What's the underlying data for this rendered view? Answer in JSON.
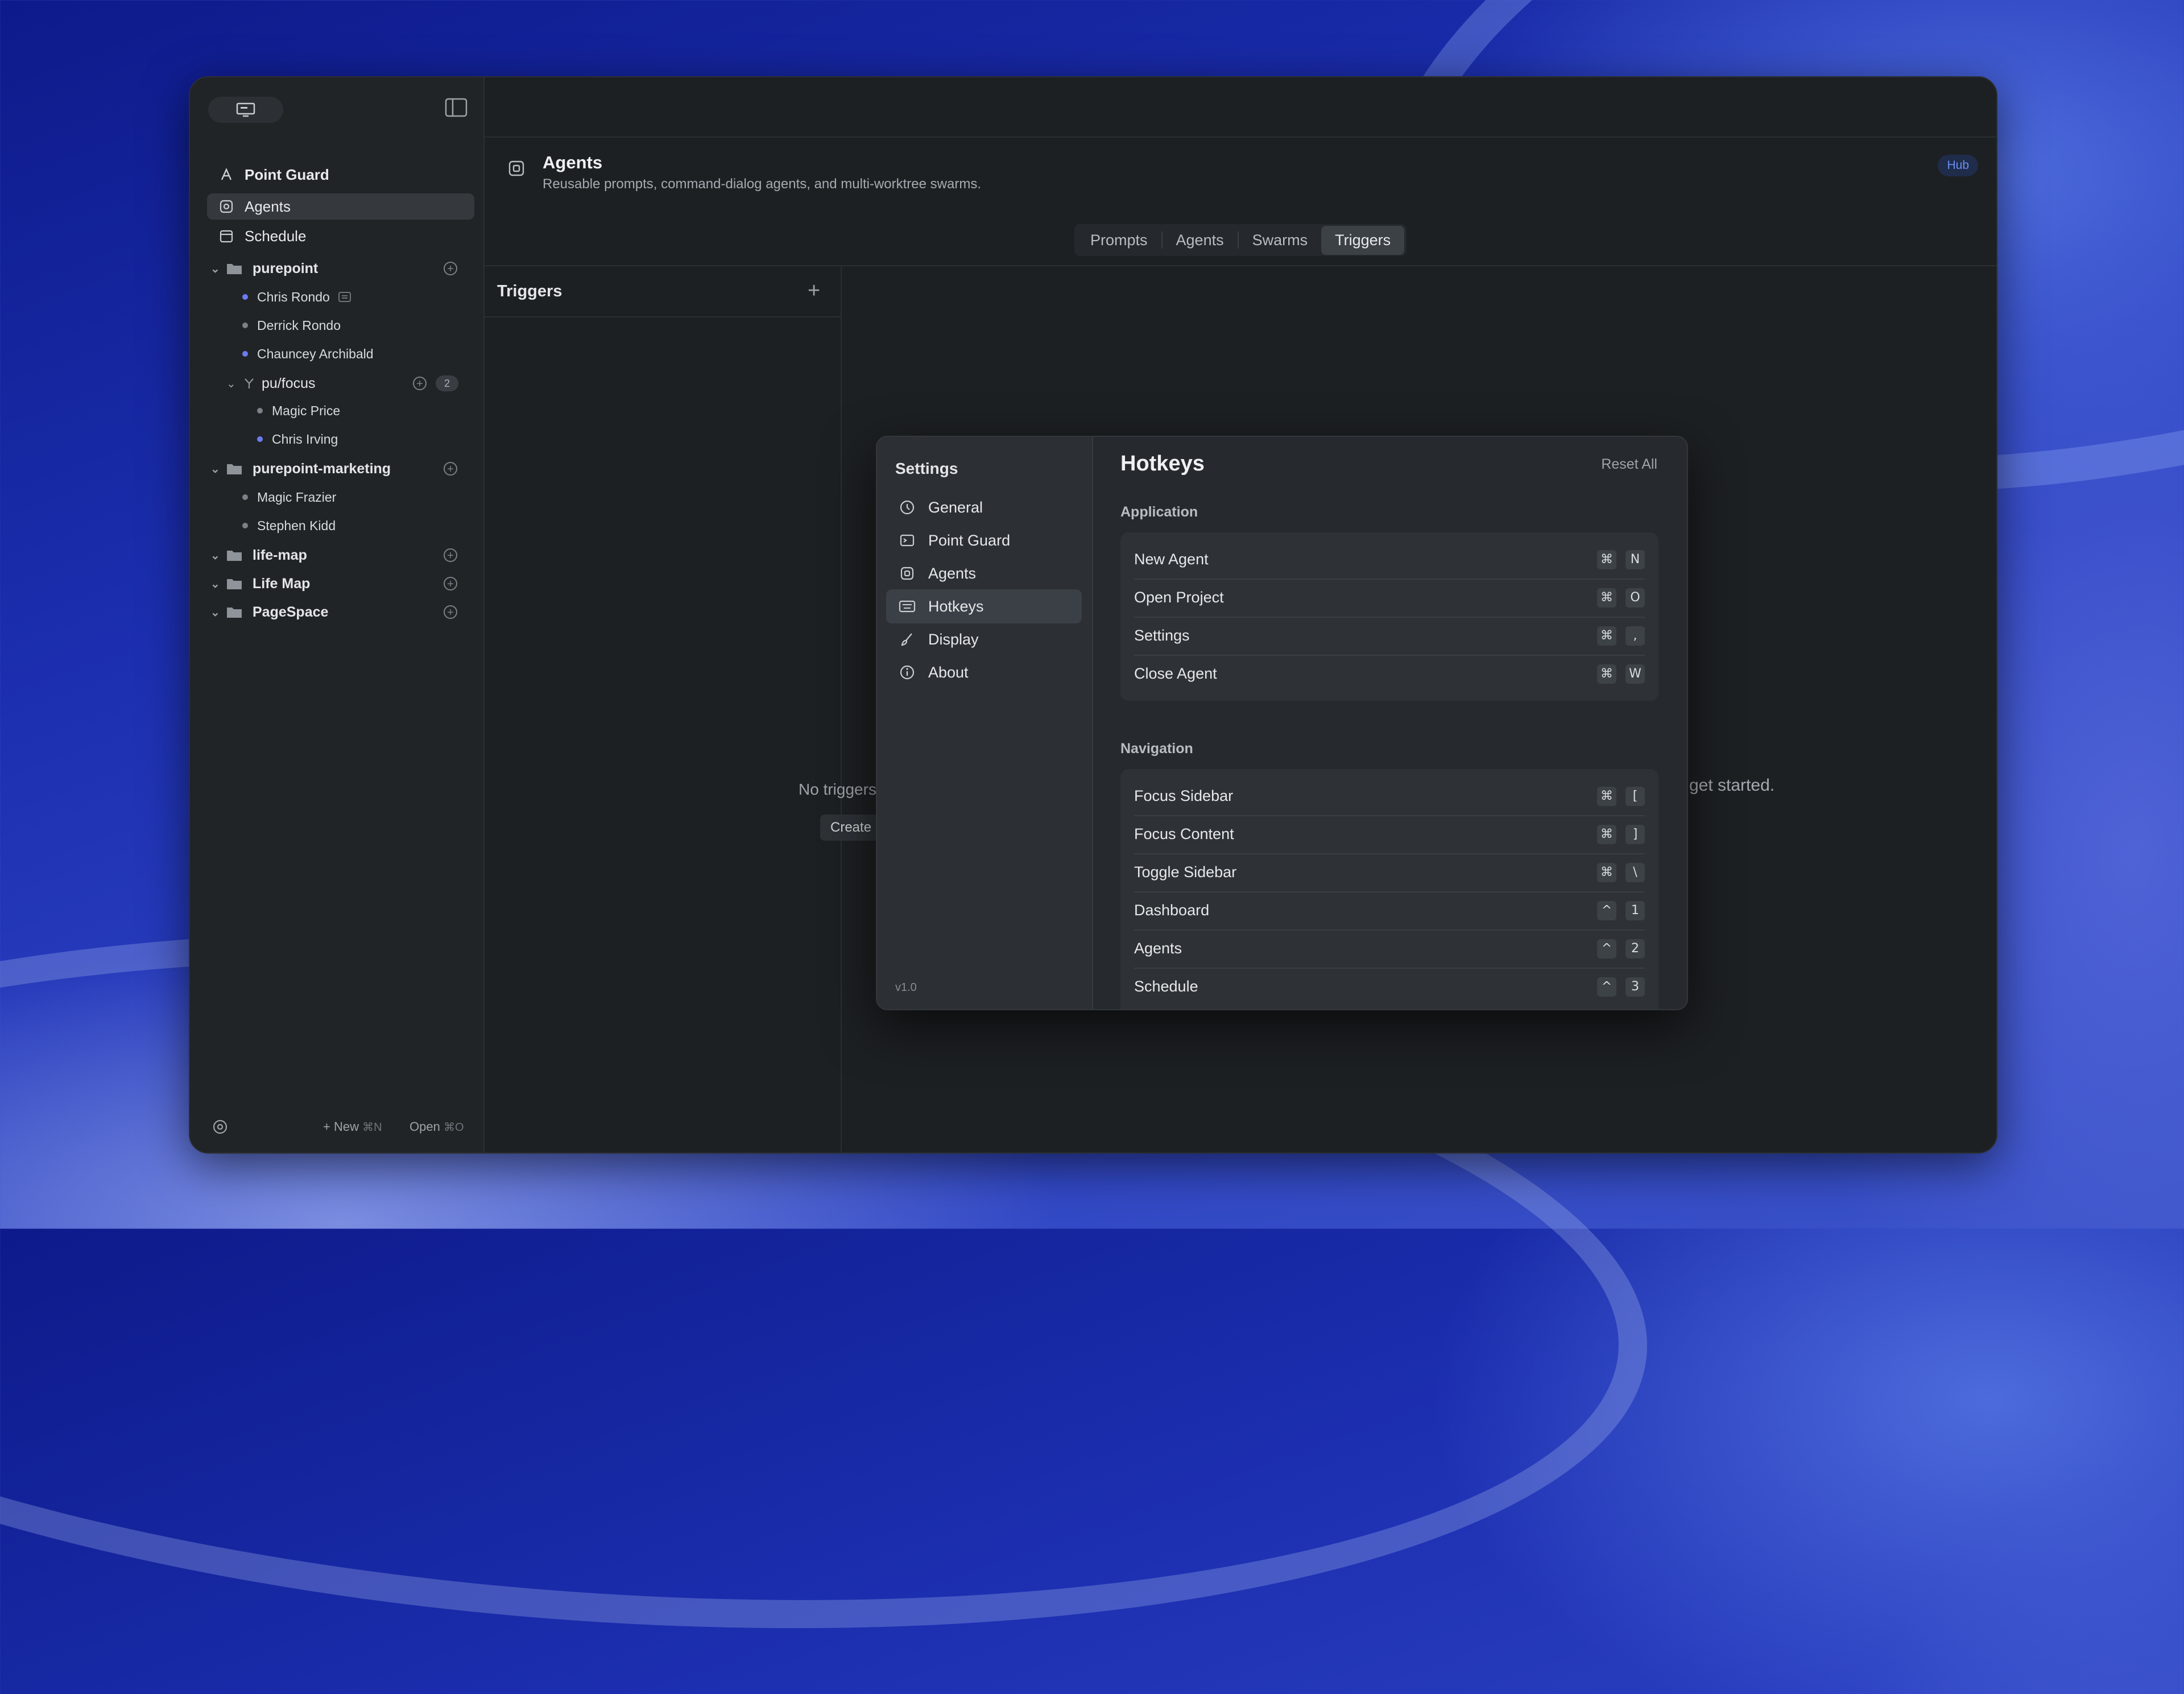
{
  "sidebar": {
    "top_items": [
      {
        "label": "Point Guard",
        "icon": "point-guard-icon"
      },
      {
        "label": "Agents",
        "icon": "agents-icon",
        "active": true
      },
      {
        "label": "Schedule",
        "icon": "calendar-icon"
      }
    ],
    "projects": [
      {
        "name": "purepoint",
        "children": [
          {
            "name": "Chris Rondo",
            "dot": "blue"
          },
          {
            "name": "Derrick Rondo",
            "dot": "grey"
          },
          {
            "name": "Chauncey Archibald",
            "dot": "blue"
          }
        ]
      },
      {
        "name": "pu/focus",
        "count": "2",
        "children": [
          {
            "name": "Magic Price",
            "dot": "grey"
          },
          {
            "name": "Chris Irving",
            "dot": "blue"
          }
        ]
      },
      {
        "name": "purepoint-marketing",
        "children": [
          {
            "name": "Magic Frazier",
            "dot": "grey"
          },
          {
            "name": "Stephen Kidd",
            "dot": "grey"
          }
        ]
      },
      {
        "name": "life-map"
      },
      {
        "name": "Life Map"
      },
      {
        "name": "PageSpace"
      }
    ],
    "footer": {
      "new_label": "New",
      "new_shortcut": "⌘N",
      "open_label": "Open",
      "open_shortcut": "⌘O"
    }
  },
  "header": {
    "title": "Agents",
    "subtitle": "Reusable prompts, command-dialog agents, and multi-worktree swarms.",
    "badge": "Hub"
  },
  "tabs": [
    {
      "label": "Prompts"
    },
    {
      "label": "Agents"
    },
    {
      "label": "Swarms"
    },
    {
      "label": "Triggers",
      "active": true
    }
  ],
  "triggers": {
    "title": "Triggers",
    "empty_text": "No triggers",
    "create_label": "Create",
    "get_started_text": "get started."
  },
  "settings": {
    "heading": "Settings",
    "nav": [
      {
        "label": "General",
        "icon": "general-icon"
      },
      {
        "label": "Point Guard",
        "icon": "point-guard-icon"
      },
      {
        "label": "Agents",
        "icon": "agents-icon"
      },
      {
        "label": "Hotkeys",
        "icon": "keyboard-icon",
        "active": true
      },
      {
        "label": "Display",
        "icon": "brush-icon"
      },
      {
        "label": "About",
        "icon": "info-icon"
      }
    ],
    "version": "v1.0",
    "title": "Hotkeys",
    "reset_label": "Reset All",
    "sections": [
      {
        "label": "Application",
        "rows": [
          {
            "label": "New Agent",
            "keys": [
              "⌘",
              "N"
            ]
          },
          {
            "label": "Open Project",
            "keys": [
              "⌘",
              "O"
            ]
          },
          {
            "label": "Settings",
            "keys": [
              "⌘",
              ","
            ]
          },
          {
            "label": "Close Agent",
            "keys": [
              "⌘",
              "W"
            ]
          }
        ]
      },
      {
        "label": "Navigation",
        "rows": [
          {
            "label": "Focus Sidebar",
            "keys": [
              "⌘",
              "["
            ]
          },
          {
            "label": "Focus Content",
            "keys": [
              "⌘",
              "]"
            ]
          },
          {
            "label": "Toggle Sidebar",
            "keys": [
              "⌘",
              "\\"
            ]
          },
          {
            "label": "Dashboard",
            "keys": [
              "^",
              "1"
            ]
          },
          {
            "label": "Agents",
            "keys": [
              "^",
              "2"
            ]
          },
          {
            "label": "Schedule",
            "keys": [
              "^",
              "3"
            ]
          }
        ]
      }
    ]
  },
  "colors": {
    "accent_blue": "#6a8ff0",
    "dot_blue": "#6b7cf0",
    "window_bg": "#1d2023"
  }
}
